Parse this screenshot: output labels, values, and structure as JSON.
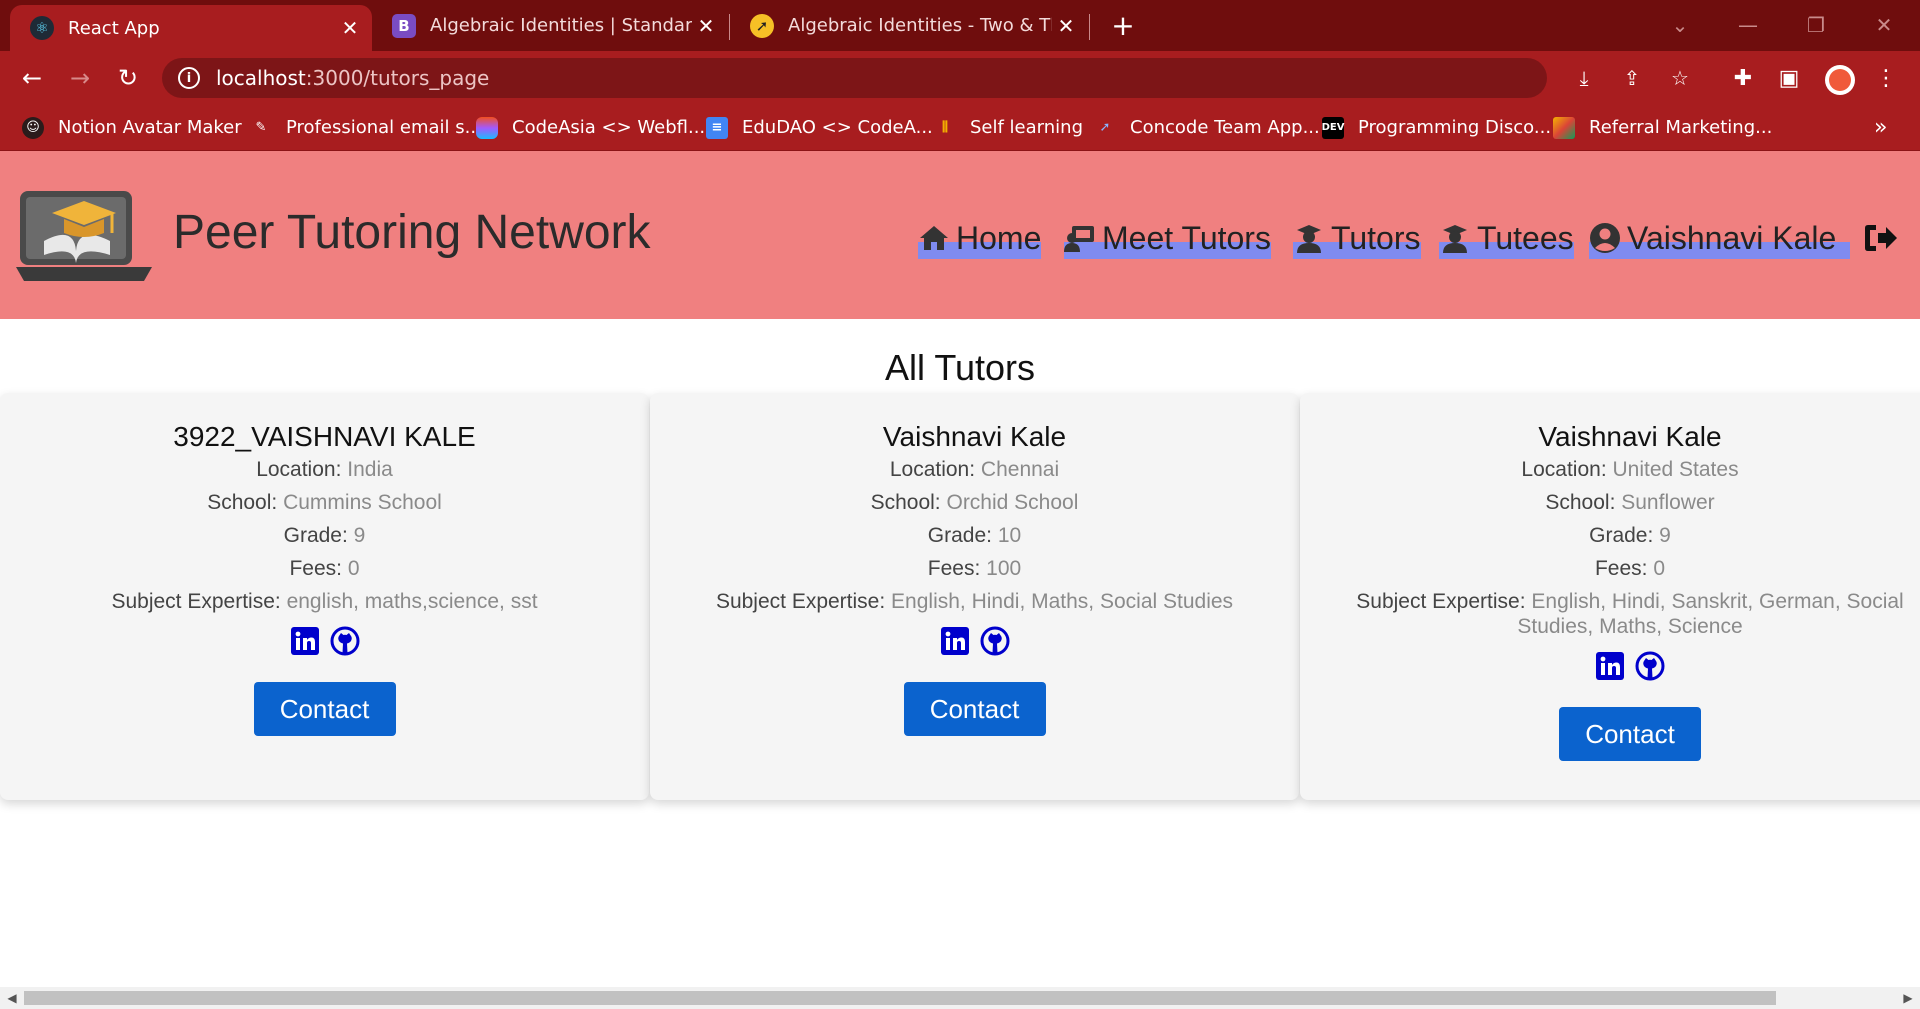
{
  "browser": {
    "tabs": [
      {
        "title": "React App",
        "icon": "react-icon",
        "active": true
      },
      {
        "title": "Algebraic Identities | Standard Alg",
        "icon": "bootstrap-icon",
        "active": false
      },
      {
        "title": "Algebraic Identities - Two & Three",
        "icon": "rocket-icon",
        "active": false
      }
    ],
    "url_host": "localhost",
    "url_path": ":3000/tutors_page",
    "bookmarks": [
      {
        "label": "Notion Avatar Maker",
        "icon": "notion-avatar-icon"
      },
      {
        "label": "Professional email s...",
        "icon": "email-icon"
      },
      {
        "label": "CodeAsia <> Webfl...",
        "icon": "figma-icon"
      },
      {
        "label": "EduDAO <> CodeA...",
        "icon": "docs-icon"
      },
      {
        "label": "Self learning",
        "icon": "chart-icon"
      },
      {
        "label": "Concode Team App...",
        "icon": "rocket-icon"
      },
      {
        "label": "Programming Disco...",
        "icon": "dev-icon"
      },
      {
        "label": "Referral Marketing...",
        "icon": "slides-icon"
      }
    ],
    "accent": "#a81d1f",
    "tabstrip_color": "#6f0d0d"
  },
  "site": {
    "title": "Peer Tutoring Network",
    "header_color": "#f08080",
    "nav": [
      {
        "label": "Home",
        "icon": "home-icon"
      },
      {
        "label": "Meet Tutors",
        "icon": "chalkboard-teacher-icon"
      },
      {
        "label": "Tutors",
        "icon": "graduate-icon"
      },
      {
        "label": "Tutees",
        "icon": "graduate-icon"
      },
      {
        "label": "Vaishnavi Kale",
        "icon": "user-circle-icon"
      }
    ],
    "logout_icon": "sign-out-icon"
  },
  "main": {
    "section_title": "All Tutors",
    "labels": {
      "location": "Location:",
      "school": "School:",
      "grade": "Grade:",
      "fees": "Fees:",
      "subjects": "Subject Expertise:"
    },
    "contact_label": "Contact",
    "button_color": "#0b63ce",
    "tutors": [
      {
        "name": "3922_VAISHNAVI KALE",
        "location": "India",
        "school": "Cummins School",
        "grade": "9",
        "fees": "0",
        "subjects": "english, maths,science, sst"
      },
      {
        "name": "Vaishnavi Kale",
        "location": "Chennai",
        "school": "Orchid School",
        "grade": "10",
        "fees": "100",
        "subjects": "English, Hindi, Maths, Social Studies"
      },
      {
        "name": "Vaishnavi Kale",
        "location": "United States",
        "school": "Sunflower",
        "grade": "9",
        "fees": "0",
        "subjects": "English, Hindi, Sanskrit, German, Social Studies, Maths, Science"
      }
    ]
  }
}
